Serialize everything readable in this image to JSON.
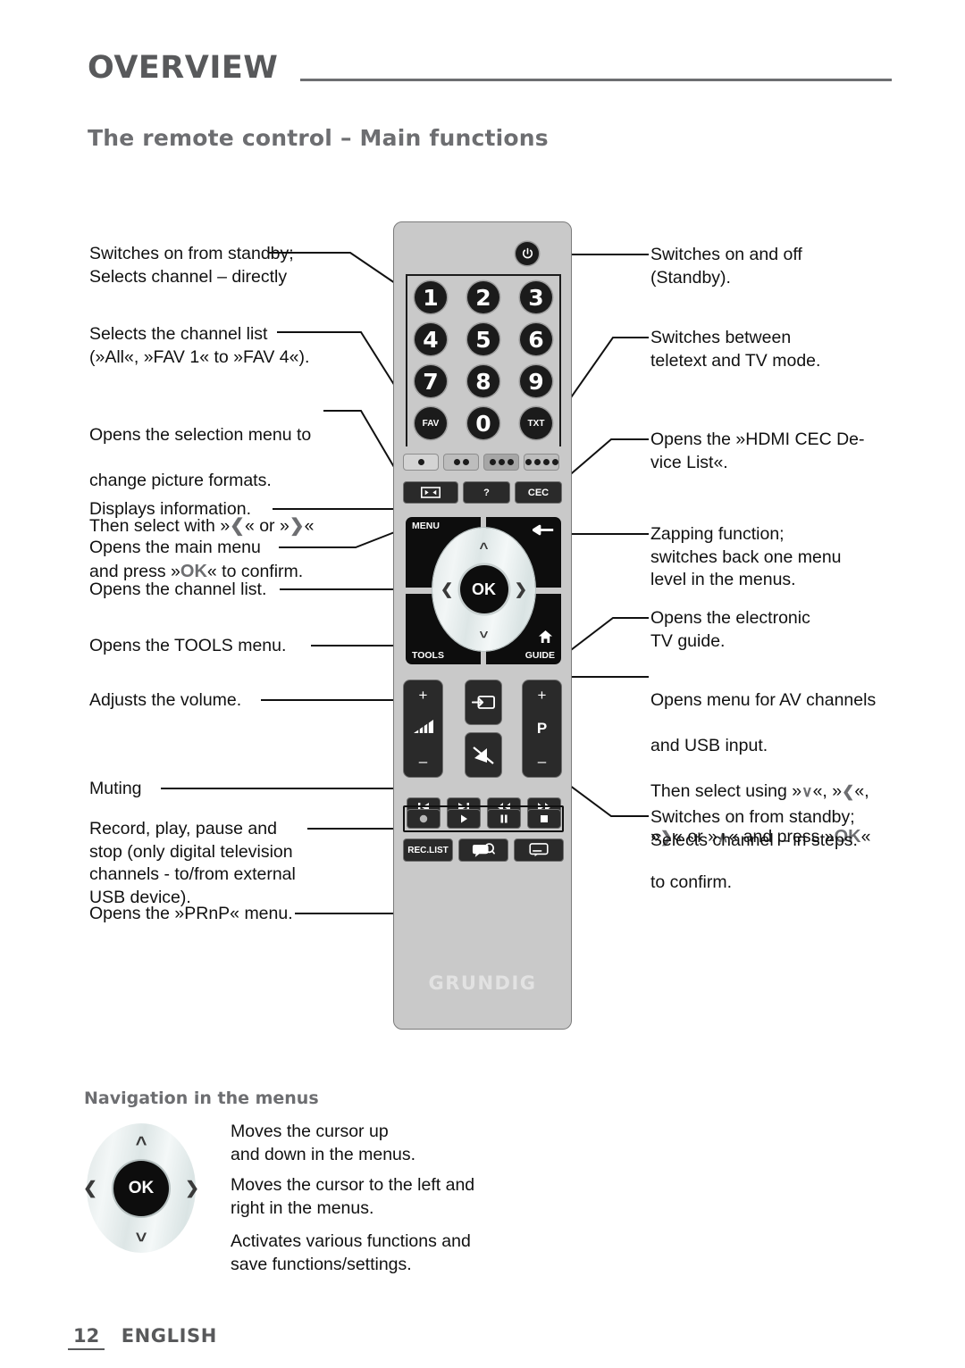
{
  "header": {
    "section": "OVERVIEW",
    "title": "The remote control – Main functions"
  },
  "callouts_left": [
    {
      "id": "standby-direct",
      "text": "Switches on from standby;\nSelects channel – directly"
    },
    {
      "id": "channel-list-fav",
      "text": "Selects the channel list\n(»All«, »FAV 1« to »FAV 4«)."
    },
    {
      "id": "picture-format",
      "text_line1": "Opens the selection menu to",
      "text_line2": "change picture formats.",
      "text_line3_a": "Then select with »",
      "text_line3_sym1": "❮",
      "text_line3_b": "« or »",
      "text_line3_sym2": "❯",
      "text_line3_c": "«",
      "text_line4_a": "and press »",
      "text_line4_sym": "OK",
      "text_line4_b": "« to confirm."
    },
    {
      "id": "display-info",
      "text": "Displays information."
    },
    {
      "id": "main-menu",
      "text": "Opens the main menu"
    },
    {
      "id": "channel-list",
      "text": "Opens the channel list."
    },
    {
      "id": "tools-menu",
      "text": "Opens the TOOLS menu."
    },
    {
      "id": "volume",
      "text": "Adjusts the volume."
    },
    {
      "id": "muting",
      "text": "Muting"
    },
    {
      "id": "record-play",
      "text": "Record, play, pause and\nstop (only digital television\nchannels - to/from external\nUSB device)."
    },
    {
      "id": "prnp-menu",
      "text": "Opens the »PRnP« menu."
    }
  ],
  "callouts_right": [
    {
      "id": "standby-onoff",
      "text": "Switches on and off\n(Standby)."
    },
    {
      "id": "teletext",
      "text": "Switches between\nteletext and TV mode."
    },
    {
      "id": "hdmi-cec",
      "text": "Opens the »HDMI CEC De-\nvice List«."
    },
    {
      "id": "zapping",
      "text": "Zapping function;\nswitches back one menu\nlevel in the menus."
    },
    {
      "id": "tv-guide",
      "text": "Opens the electronic\nTV guide."
    },
    {
      "id": "av-usb",
      "line1": "Opens menu for AV channels",
      "line2": "and USB input.",
      "line3_a": "Then select using »",
      "line3_s1": "∨",
      "line3_b": "«, »",
      "line3_s2": "❮",
      "line3_c": "«,",
      "line4_a": "»",
      "line4_s1": "❯",
      "line4_b": "« or »",
      "line4_s2": "∧",
      "line4_c": "« and press »",
      "line4_ok": "OK",
      "line4_d": "«",
      "line5": "to confirm."
    },
    {
      "id": "standby-steps",
      "text": "Switches on from standby;\nSelects channel – in steps."
    }
  ],
  "remote": {
    "brand": "GRUNDIG",
    "power_icon": "power-icon",
    "number_keys": [
      "1",
      "2",
      "3",
      "4",
      "5",
      "6",
      "7",
      "8",
      "9",
      "0"
    ],
    "fav_label": "FAV",
    "txt_label": "TXT",
    "colour_keys": [
      {
        "name": "red-key",
        "dots": 1
      },
      {
        "name": "green-key",
        "dots": 2
      },
      {
        "name": "yellow-key",
        "dots": 3
      },
      {
        "name": "blue-key",
        "dots": 4
      }
    ],
    "function_keys": [
      {
        "name": "picture-format-key",
        "label": ""
      },
      {
        "name": "info-key",
        "label": "?"
      },
      {
        "name": "cec-key",
        "label": "CEC"
      }
    ],
    "nav": {
      "menu_label": "MENU",
      "tools_label": "TOOLS",
      "guide_label": "GUIDE",
      "ok_label": "OK",
      "back_icon": "back-arrow-icon",
      "home_icon": "home-icon"
    },
    "volume": {
      "plus": "+",
      "minus": "–",
      "icon": "volume-bars-icon"
    },
    "program": {
      "plus": "+",
      "label": "P",
      "minus": "–"
    },
    "source_icon": "av-source-icon",
    "mute_icon": "mute-icon",
    "transport_top": [
      "skip-previous-icon",
      "skip-next-icon",
      "rewind-icon",
      "fast-forward-icon"
    ],
    "transport_bottom": [
      "record-icon",
      "play-icon",
      "pause-icon",
      "stop-icon"
    ],
    "bottom_keys": [
      {
        "name": "rec-list-key",
        "label": "REC.LIST"
      },
      {
        "name": "prnp-key",
        "label": ""
      },
      {
        "name": "subtitle-key",
        "label": ""
      }
    ]
  },
  "nav_section": {
    "title": "Navigation in the menus",
    "ok_label": "OK",
    "descriptions": [
      "Moves the cursor up\nand down in the menus.",
      "Moves the cursor to the left and\nright in the menus.",
      "Activates various functions and\nsave functions/settings."
    ]
  },
  "footer": {
    "page": "12",
    "language": "ENGLISH"
  }
}
